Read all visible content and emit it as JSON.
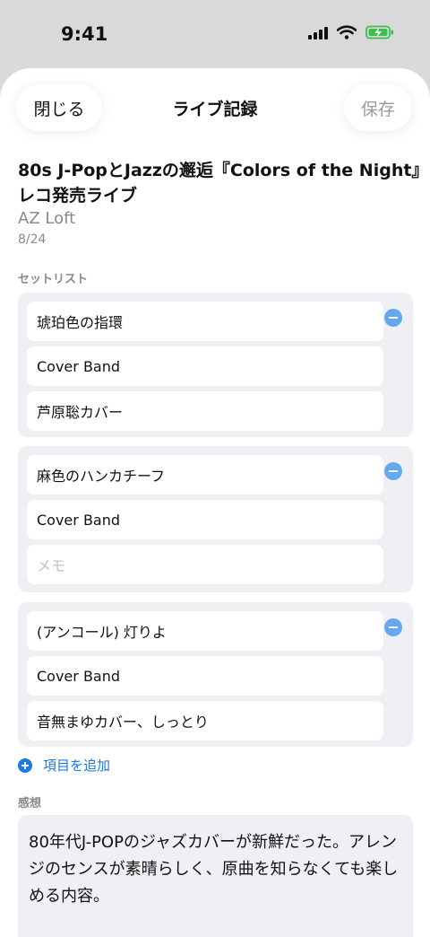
{
  "status": {
    "time": "9:41"
  },
  "nav": {
    "close_label": "閉じる",
    "title": "ライブ記録",
    "save_label": "保存"
  },
  "event": {
    "title": "80s J-PopとJazzの邂逅『Colors of the Night』レコ発売ライブ",
    "venue": "AZ Loft",
    "date": "8/24"
  },
  "setlist": {
    "label": "セットリスト",
    "items": [
      {
        "song": "琥珀色の指環",
        "artist": "Cover Band",
        "memo": "芦原聡カバー",
        "memo_placeholder": "メモ"
      },
      {
        "song": "麻色のハンカチーフ",
        "artist": "Cover Band",
        "memo": "",
        "memo_placeholder": "メモ"
      },
      {
        "song": "(アンコール) 灯りよ",
        "artist": "Cover Band",
        "memo": "音無まゆカバー、しっとり",
        "memo_placeholder": "メモ"
      }
    ],
    "add_label": "項目を追加"
  },
  "impression": {
    "label": "感想",
    "text": "80年代J-POPのジャズカバーが新鮮だった。アレンジのセンスが素晴らしく、原曲を知らなくても楽しめる内容。"
  },
  "colors": {
    "accent": "#1a7ae6",
    "remove": "#64a8ef",
    "group_bg": "#f0f0f4"
  }
}
